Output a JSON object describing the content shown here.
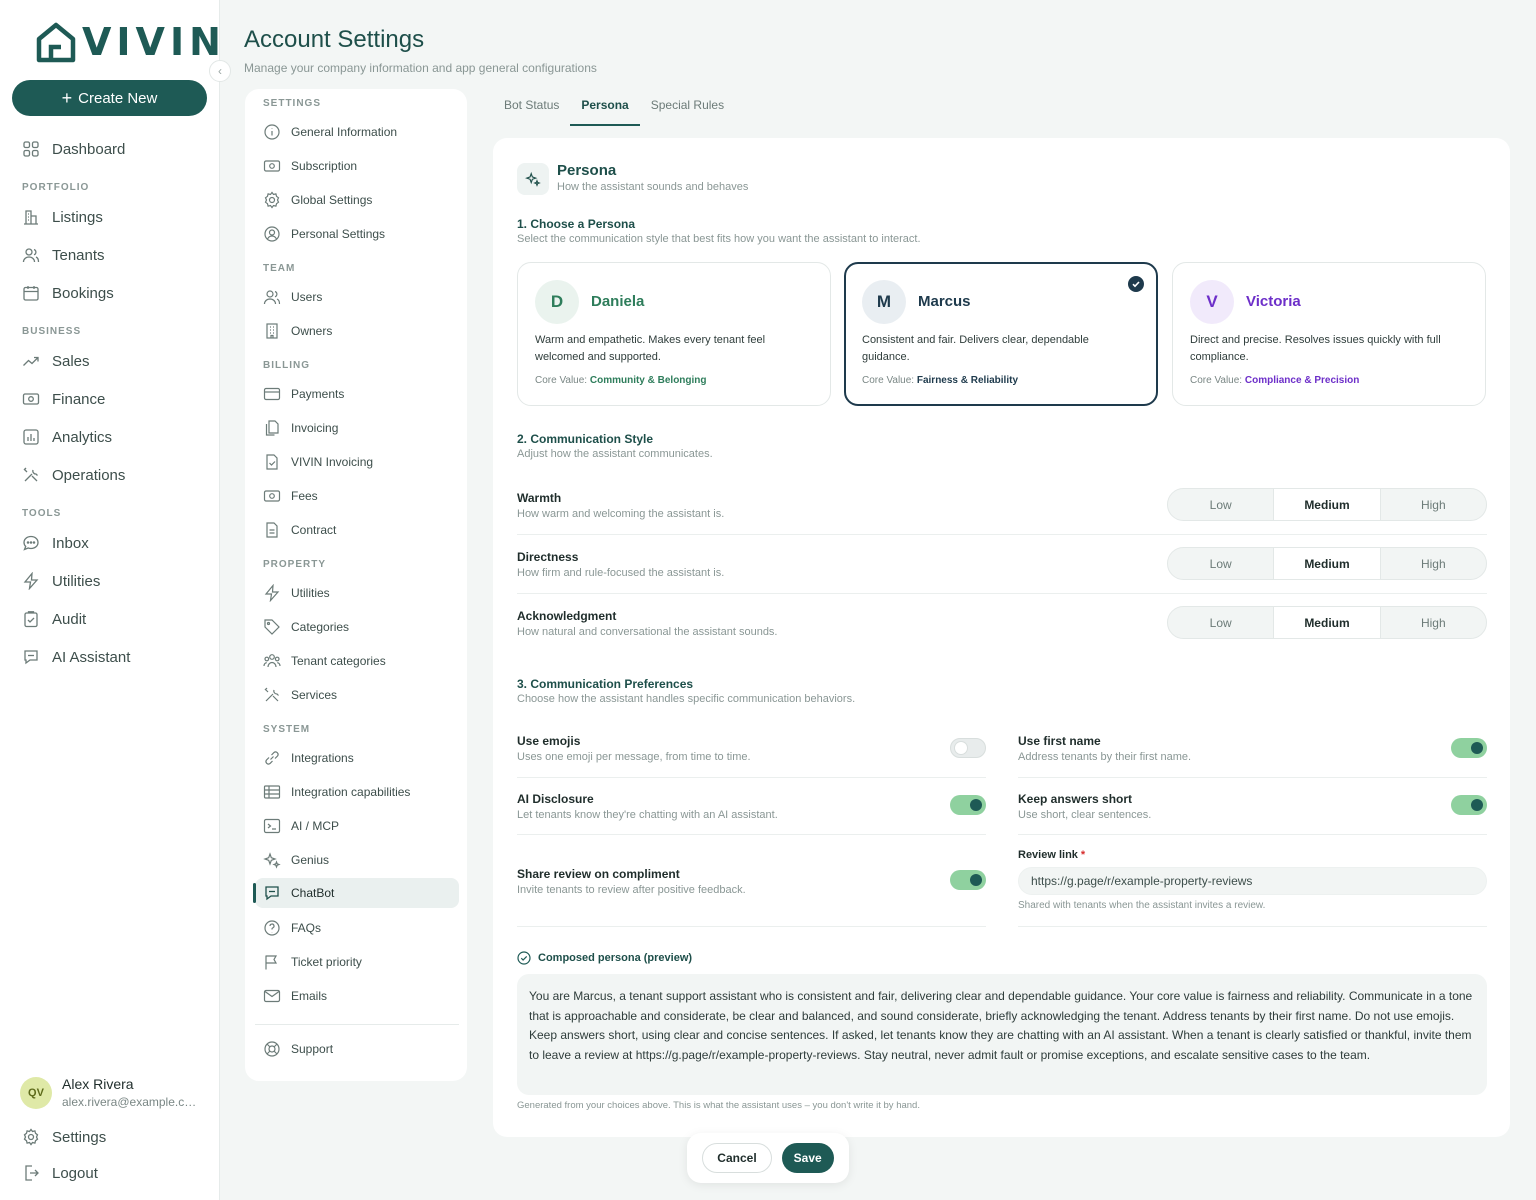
{
  "app": {
    "logo_text": "VIVIN",
    "create_label": "Create New",
    "brand_color": "#1e5a55"
  },
  "nav": {
    "dashboard": "Dashboard",
    "portfolio_head": "PORTFOLIO",
    "listings": "Listings",
    "tenants": "Tenants",
    "bookings": "Bookings",
    "business_head": "BUSINESS",
    "sales": "Sales",
    "finance": "Finance",
    "analytics": "Analytics",
    "operations": "Operations",
    "tools_head": "TOOLS",
    "inbox": "Inbox",
    "utilities": "Utilities",
    "audit": "Audit",
    "ai_assistant": "AI Assistant",
    "settings": "Settings",
    "logout": "Logout"
  },
  "user": {
    "initials": "QV",
    "name": "Alex Rivera",
    "email": "alex.rivera@example.com"
  },
  "header": {
    "title": "Account Settings",
    "subtitle": "Manage your company information and app general configurations"
  },
  "settings_menu": {
    "settings_head": "SETTINGS",
    "general_information": "General Information",
    "subscription": "Subscription",
    "global_settings": "Global Settings",
    "personal_settings": "Personal Settings",
    "team_head": "TEAM",
    "users": "Users",
    "owners": "Owners",
    "billing_head": "BILLING",
    "payments": "Payments",
    "invoicing": "Invoicing",
    "vivin_invoicing": "VIVIN Invoicing",
    "fees": "Fees",
    "contract": "Contract",
    "property_head": "PROPERTY",
    "utilities": "Utilities",
    "categories": "Categories",
    "tenant_categories": "Tenant categories",
    "services": "Services",
    "system_head": "SYSTEM",
    "integrations": "Integrations",
    "integration_capabilities": "Integration capabilities",
    "ai_mcp": "AI / MCP",
    "genius": "Genius",
    "chatbot": "ChatBot",
    "faqs": "FAQs",
    "ticket_priority": "Ticket priority",
    "emails": "Emails",
    "support": "Support"
  },
  "tabs": {
    "bot_status": "Bot Status",
    "persona": "Persona",
    "special_rules": "Special Rules",
    "active": "Persona"
  },
  "persona": {
    "title": "Persona",
    "subtitle": "How the assistant sounds and behaves",
    "choose_title": "1. Choose a Persona",
    "choose_sub": "Select the communication style that best fits how you want the assistant to interact.",
    "core_value_label": "Core Value:",
    "cards": [
      {
        "initial": "D",
        "name": "Daniela",
        "desc": "Warm and empathetic. Makes every tenant feel welcomed and supported.",
        "core": "Community & Belonging",
        "color": "#2e7d5b",
        "bg": "#eaf3ee"
      },
      {
        "initial": "M",
        "name": "Marcus",
        "desc": "Consistent and fair. Delivers clear, dependable guidance.",
        "core": "Fairness & Reliability",
        "color": "#1e3a4c",
        "bg": "#e9eef2"
      },
      {
        "initial": "V",
        "name": "Victoria",
        "desc": "Direct and precise. Resolves issues quickly with full compliance.",
        "core": "Compliance & Precision",
        "color": "#6d2fc9",
        "bg": "#f1eafb"
      }
    ],
    "selected": "Marcus"
  },
  "style": {
    "title": "2. Communication Style",
    "sub": "Adjust how the assistant communicates.",
    "options": [
      "Low",
      "Medium",
      "High"
    ],
    "rows": [
      {
        "title": "Warmth",
        "sub": "How warm and welcoming the assistant is.",
        "value": "Medium"
      },
      {
        "title": "Directness",
        "sub": "How firm and rule-focused the assistant is.",
        "value": "Medium"
      },
      {
        "title": "Acknowledgment",
        "sub": "How natural and conversational the assistant sounds.",
        "value": "Medium"
      }
    ]
  },
  "prefs": {
    "title": "3. Communication Preferences",
    "sub": "Choose how the assistant handles specific communication behaviors.",
    "use_emojis": {
      "title": "Use emojis",
      "sub": "Uses one emoji per message, from time to time.",
      "on": false
    },
    "use_first_name": {
      "title": "Use first name",
      "sub": "Address tenants by their first name.",
      "on": true
    },
    "ai_disclosure": {
      "title": "AI Disclosure",
      "sub": "Let tenants know they're chatting with an AI assistant.",
      "on": true
    },
    "keep_short": {
      "title": "Keep answers short",
      "sub": "Use short, clear sentences.",
      "on": true
    },
    "share_review": {
      "title": "Share review on compliment",
      "sub": "Invite tenants to review after positive feedback.",
      "on": true
    },
    "review_link_label": "Review link",
    "review_link_required": "*",
    "review_link_value": "https://g.page/r/example-property-reviews",
    "review_link_hint": "Shared with tenants when the assistant invites a review."
  },
  "preview": {
    "title": "Composed persona (preview)",
    "text": "You are Marcus, a tenant support assistant who is consistent and fair, delivering clear and dependable guidance. Your core value is fairness and reliability. Communicate in a tone that is approachable and considerate, be clear and balanced, and sound considerate, briefly acknowledging the tenant. Address tenants by their first name. Do not use emojis. Keep answers short, using clear and concise sentences. If asked, let tenants know they are chatting with an AI assistant. When a tenant is clearly satisfied or thankful, invite them to leave a review at https://g.page/r/example-property-reviews. Stay neutral, never admit fault or promise exceptions, and escalate sensitive cases to the team.",
    "footnote": "Generated from your choices above. This is what the assistant uses – you don't write it by hand."
  },
  "actions": {
    "cancel": "Cancel",
    "save": "Save"
  }
}
